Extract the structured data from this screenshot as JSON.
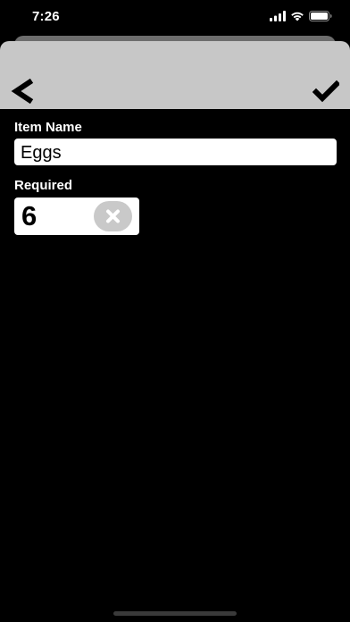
{
  "status_bar": {
    "time": "7:26",
    "icons": [
      "cellular-signal-icon",
      "wifi-icon",
      "battery-icon"
    ]
  },
  "nav": {
    "back_icon": "chevron-left-icon",
    "done_icon": "checkmark-icon",
    "bar_color": "#c7c7c7"
  },
  "form": {
    "item_name": {
      "label": "Item Name",
      "value": "Eggs"
    },
    "required": {
      "label": "Required",
      "value": "6",
      "clear_icon": "clear-x-icon"
    }
  },
  "colors": {
    "background": "#000000",
    "field_background": "#ffffff",
    "clear_button": "#c9c9c9"
  }
}
